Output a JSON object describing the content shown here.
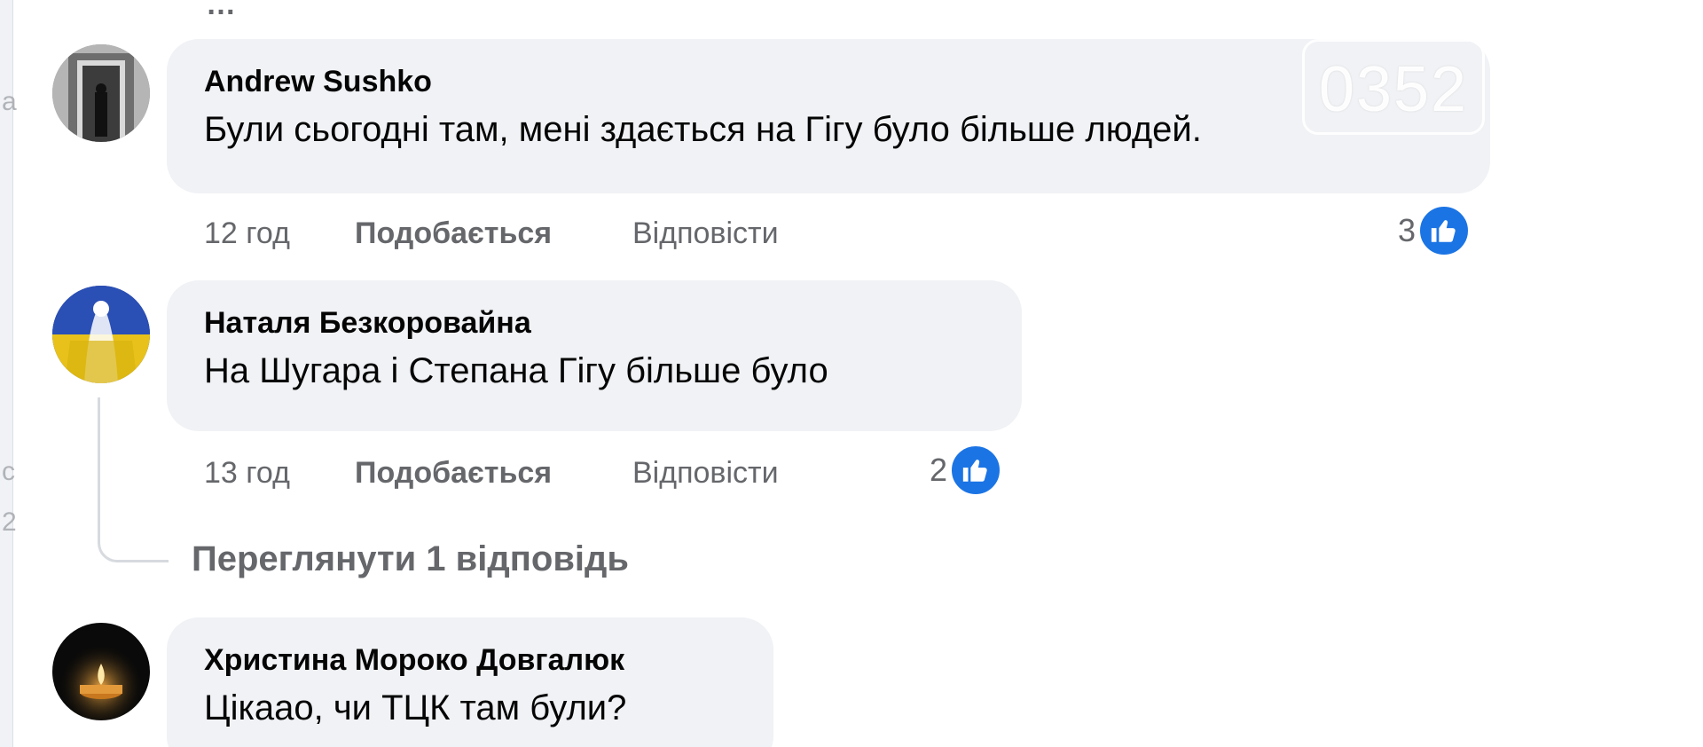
{
  "top_partial_text": "…",
  "watermark": "0352",
  "colors": {
    "bubble": "#f0f2f5",
    "meta_text": "#65676b",
    "like_blue": "#1b74e4"
  },
  "comments": [
    {
      "author": "Andrew Sushko",
      "text": "Були сьогодні там, мені здається на Гігу було більше людей.",
      "time": "12 год",
      "like_label": "Подобається",
      "reply_label": "Відповісти",
      "reaction_count": "3",
      "reaction_icon": "thumbs-up-icon"
    },
    {
      "author": "Наталя Безкоровайна",
      "text": "На Шугара і Степана Гігу більше було",
      "time": "13 год",
      "like_label": "Подобається",
      "reply_label": "Відповісти",
      "reaction_count": "2",
      "reaction_icon": "thumbs-up-icon"
    },
    {
      "author": "Христина Мороко Довгалюк",
      "text": "Цікаао, чи ТЦК там були?"
    }
  ],
  "view_replies_label": "Переглянути 1 відповідь"
}
